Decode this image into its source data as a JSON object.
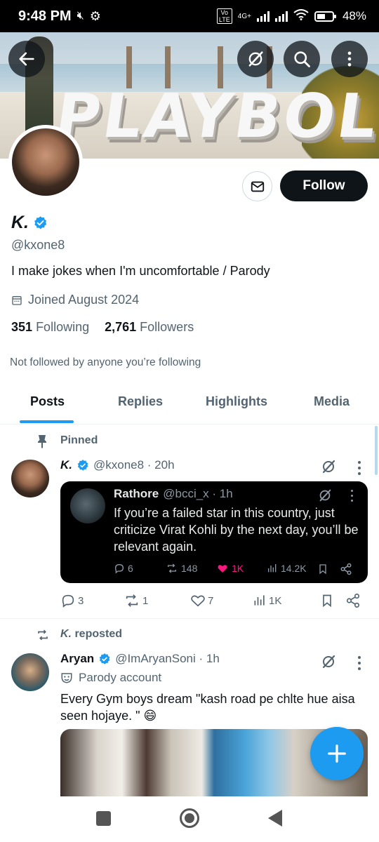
{
  "status_bar": {
    "time": "9:48 PM",
    "network_label": "4G+",
    "volte_label": "Vo LTE",
    "battery": "48%"
  },
  "banner": {
    "text": "PLAYBOLD"
  },
  "profile": {
    "name": "K.",
    "handle": "@kxone8",
    "bio": "I make jokes when I'm uncomfortable / Parody",
    "joined": "Joined August 2024",
    "following_count": "351",
    "following_label": "Following",
    "followers_count": "2,761",
    "followers_label": "Followers",
    "not_followed": "Not followed by anyone you’re following",
    "follow_label": "Follow"
  },
  "tabs": [
    {
      "label": "Posts",
      "active": true
    },
    {
      "label": "Replies"
    },
    {
      "label": "Highlights"
    },
    {
      "label": "Media"
    }
  ],
  "tweet1": {
    "pinned_label": "Pinned",
    "name": "K.",
    "handle_time": "@kxone8 · 20h",
    "quote": {
      "name": "Rathore",
      "handle_time": "@bcci_x · 1h",
      "text": "If you’re a failed star in this country, just criticize Virat Kohli by the next day, you’ll be relevant again.",
      "replies": "6",
      "reposts": "148",
      "likes": "1K",
      "views": "14.2K"
    },
    "replies": "3",
    "reposts": "1",
    "likes": "7",
    "views": "1K"
  },
  "tweet2": {
    "reposted_by": "K.",
    "reposted_suffix": " reposted",
    "name": "Aryan",
    "handle_time": "@ImAryanSoni · 1h",
    "parody_label": "Parody account",
    "text": "Every Gym boys dream \"kash road pe chlte hue  aisa seen hojaye. \" 😄"
  },
  "colors": {
    "accent": "#1d9bf0",
    "like": "#f91880",
    "text_secondary": "#536471"
  }
}
